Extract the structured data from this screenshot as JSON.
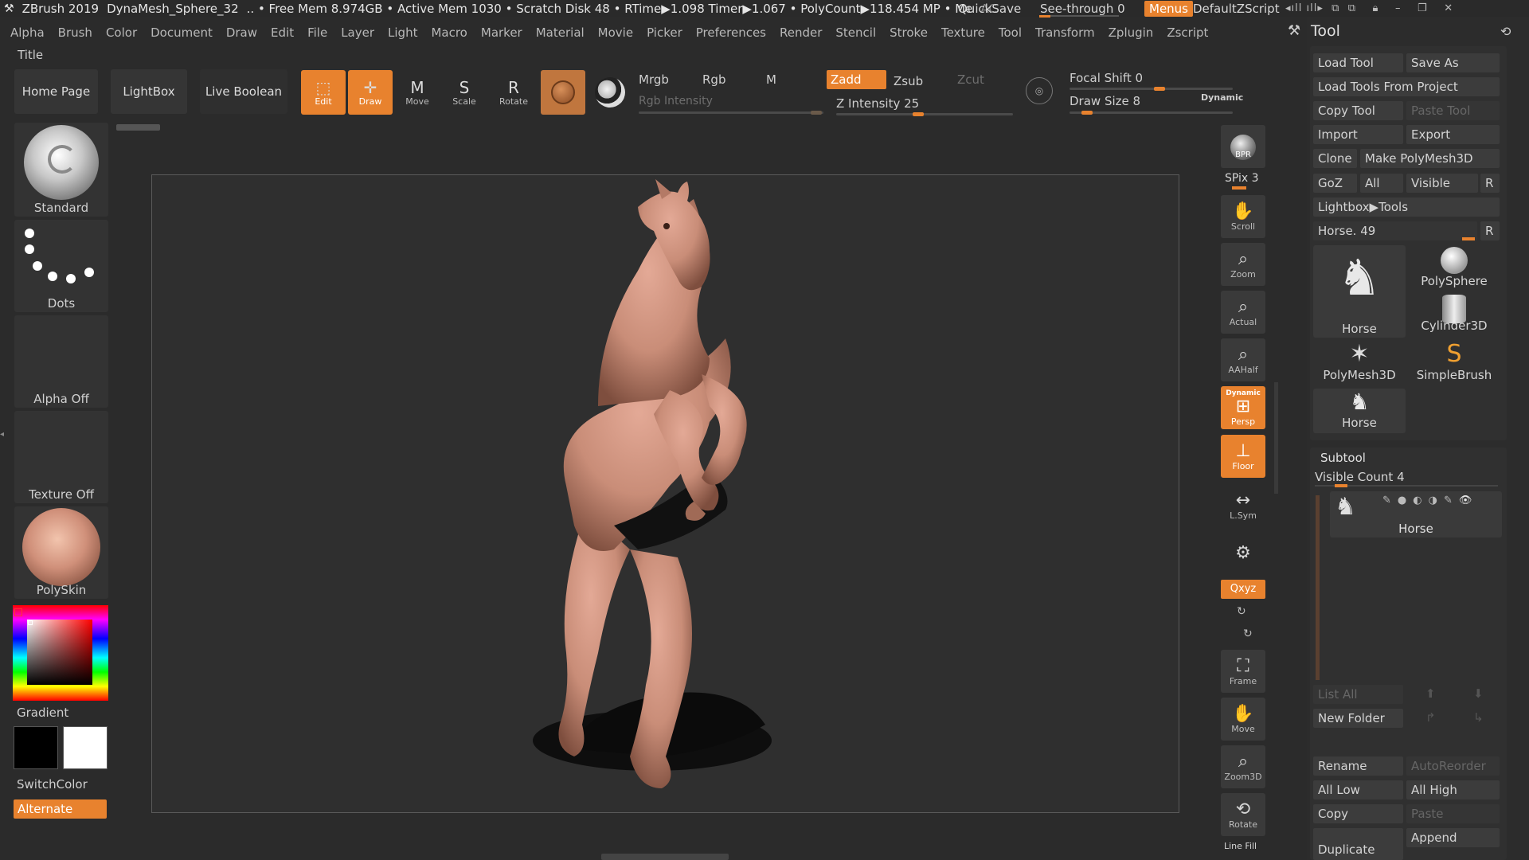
{
  "titlebar": {
    "app_name": "ZBrush 2019",
    "document": "DynaMesh_Sphere_32",
    "stats": ".. • Free Mem 8.974GB • Active Mem 1030 • Scratch Disk 48 •  RTime▶1.098 Timer▶1.067 • PolyCount▶118.454 MP • Me",
    "ac": "AC",
    "quicksave": "QuickSave",
    "see_through_label": "See-through",
    "see_through_value": "0",
    "menus": "Menus",
    "script": "DefaultZScript"
  },
  "menubar": [
    "Alpha",
    "Brush",
    "Color",
    "Document",
    "Draw",
    "Edit",
    "File",
    "Layer",
    "Light",
    "Macro",
    "Marker",
    "Material",
    "Movie",
    "Picker",
    "Preferences",
    "Render",
    "Stencil",
    "Stroke",
    "Texture",
    "Tool",
    "Transform",
    "Zplugin",
    "Zscript"
  ],
  "title_label": "Title",
  "toolbar": {
    "home_page": "Home Page",
    "lightbox": "LightBox",
    "live_boolean": "Live Boolean",
    "edit": "Edit",
    "draw": "Draw",
    "move": "Move",
    "scale": "Scale",
    "rotate": "Rotate",
    "mrgb": "Mrgb",
    "rgb": "Rgb",
    "m": "M",
    "zadd": "Zadd",
    "zsub": "Zsub",
    "zcut": "Zcut",
    "rgb_intensity": "Rgb Intensity",
    "z_intensity_label": "Z Intensity",
    "z_intensity_value": "25",
    "z_intensity_fraction": 0.25,
    "focal_shift_label": "Focal Shift",
    "focal_shift_value": "0",
    "draw_size_label": "Draw Size",
    "draw_size_value": "8",
    "dynamic": "Dynamic"
  },
  "left_shelf": {
    "brush": "Standard",
    "stroke": "Dots",
    "alpha": "Alpha Off",
    "texture": "Texture Off",
    "material": "PolySkin",
    "gradient": "Gradient",
    "switch_color": "SwitchColor",
    "alternate": "Alternate"
  },
  "right_shelf": {
    "bpr": "BPR",
    "spix_label": "SPix",
    "spix_value": "3",
    "scroll": "Scroll",
    "zoom": "Zoom",
    "actual": "Actual",
    "aahalf": "AAHalf",
    "persp_dynamic": "Dynamic",
    "persp": "Persp",
    "floor": "Floor",
    "lsym": "L.Sym",
    "xyz": "Qxyz",
    "frame": "Frame",
    "move": "Move",
    "zoom3d": "Zoom3D",
    "rotate": "Rotate",
    "line_fill": "Line Fill"
  },
  "tool_panel": {
    "title": "Tool",
    "load_tool": "Load Tool",
    "save_as": "Save As",
    "load_from_project": "Load Tools From Project",
    "copy_tool": "Copy Tool",
    "paste_tool": "Paste Tool",
    "import": "Import",
    "export": "Export",
    "clone": "Clone",
    "make_polymesh": "Make PolyMesh3D",
    "goz": "GoZ",
    "all": "All",
    "visible": "Visible",
    "r": "R",
    "lightbox_tools": "Lightbox▶Tools",
    "current_tool_label": "Horse.",
    "current_tool_value": "49",
    "thumbnails": [
      "Horse",
      "PolySphere",
      "Cylinder3D",
      "PolyMesh3D",
      "SimpleBrush",
      "Horse"
    ],
    "subtool_title": "Subtool",
    "visible_count_label": "Visible Count",
    "visible_count_value": "4",
    "subtool_name": "Horse",
    "list_all": "List All",
    "new_folder": "New Folder",
    "rename": "Rename",
    "auto_reorder": "AutoReorder",
    "all_low": "All Low",
    "all_high": "All High",
    "copy": "Copy",
    "paste": "Paste",
    "duplicate": "Duplicate",
    "append": "Append"
  },
  "colors": {
    "accent": "#e8822e",
    "background": "#2b2b2b",
    "model_skin": "#c98d78"
  }
}
